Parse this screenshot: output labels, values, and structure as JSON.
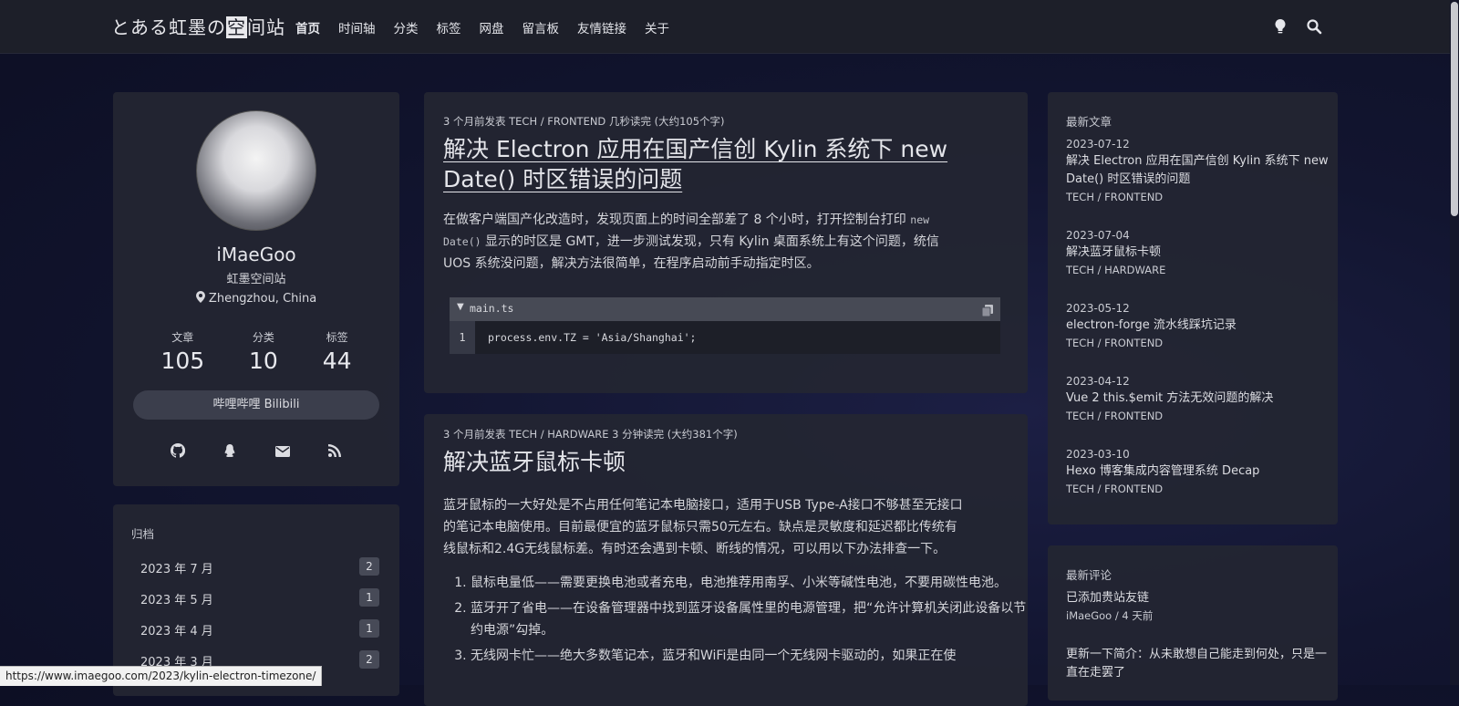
{
  "site": {
    "logo_prefix": "とある虹墨の",
    "logo_box": "空",
    "logo_suffix": "间站"
  },
  "nav": [
    "首页",
    "时间轴",
    "分类",
    "标签",
    "网盘",
    "留言板",
    "友情链接",
    "关于"
  ],
  "profile": {
    "name": "iMaeGoo",
    "subtitle": "虹墨空间站",
    "location": "Zhengzhou, China",
    "stats": [
      {
        "label": "文章",
        "value": "105"
      },
      {
        "label": "分类",
        "value": "10"
      },
      {
        "label": "标签",
        "value": "44"
      }
    ],
    "bilibili_button": "哔哩哔哩 Bilibili"
  },
  "archive": {
    "title": "归档",
    "items": [
      {
        "month": "2023 年 7 月",
        "count": "2"
      },
      {
        "month": "2023 年 5 月",
        "count": "1"
      },
      {
        "month": "2023 年 4 月",
        "count": "1"
      },
      {
        "month": "2023 年 3 月",
        "count": "2"
      }
    ]
  },
  "posts": [
    {
      "meta": "3 个月前发表   TECH / FRONTEND   几秒读完 (大约105个字)",
      "title_line1": "解决 Electron 应用在国产信创 Kylin 系统下 new",
      "title_line2": "Date() 时区错误的问题",
      "excerpt_a": "在做客户端国产化改造时，发现页面上的时间全部差了 8 个小时，打开控制台打印 ",
      "excerpt_code1": "new",
      "excerpt_code2": "Date()",
      "excerpt_b": " 显示的时区是 GMT，进一步测试发现，只有 Kylin 桌面系统上有这个问题，统信",
      "excerpt_c": "UOS 系统没问题，解决方法很简单，在程序启动前手动指定时区。",
      "code_filename": "main.ts",
      "code_line_no": "1",
      "code_line": "process.env.TZ = 'Asia/Shanghai';"
    },
    {
      "meta": "3 个月前发表   TECH / HARDWARE   3 分钟读完 (大约381个字)",
      "title": "解决蓝牙鼠标卡顿",
      "excerpt_l1": "蓝牙鼠标的一大好处是不占用任何笔记本电脑接口，适用于USB Type-A接口不够甚至无接口",
      "excerpt_l2": "的笔记本电脑使用。目前最便宜的蓝牙鼠标只需50元左右。缺点是灵敏度和延迟都比传统有",
      "excerpt_l3": "线鼠标和2.4G无线鼠标差。有时还会遇到卡顿、断线的情况，可以用以下办法排查一下。",
      "list": [
        "鼠标电量低——需要更换电池或者充电，电池推荐用南孚、小米等碱性电池，不要用碳性电池。",
        "蓝牙开了省电——在设备管理器中找到蓝牙设备属性里的电源管理，把“允许计算机关闭此设备以节约电源”勾掉。",
        "无线网卡忙——绝大多数笔记本，蓝牙和WiFi是由同一个无线网卡驱动的，如果正在使"
      ]
    }
  ],
  "recent": {
    "title": "最新文章",
    "items": [
      {
        "date": "2023-07-12",
        "title": "解决 Electron 应用在国产信创 Kylin 系统下 new Date() 时区错误的问题",
        "cat": "TECH / FRONTEND"
      },
      {
        "date": "2023-07-04",
        "title": "解决蓝牙鼠标卡顿",
        "cat": "TECH / HARDWARE"
      },
      {
        "date": "2023-05-12",
        "title": "electron-forge 流水线踩坑记录",
        "cat": "TECH / FRONTEND"
      },
      {
        "date": "2023-04-12",
        "title": "Vue 2 this.$emit 方法无效问题的解决",
        "cat": "TECH / FRONTEND"
      },
      {
        "date": "2023-03-10",
        "title": "Hexo 博客集成内容管理系统 Decap",
        "cat": "TECH / FRONTEND"
      }
    ]
  },
  "comments": {
    "title": "最新评论",
    "items": [
      {
        "text": "已添加贵站友链",
        "author": "iMaeGoo / 4 天前"
      },
      {
        "text": "更新一下简介：从未敢想自己能走到何处，只是一直在走罢了",
        "author": ""
      }
    ]
  },
  "status_url": "https://www.imaegoo.com/2023/kylin-electron-timezone/"
}
